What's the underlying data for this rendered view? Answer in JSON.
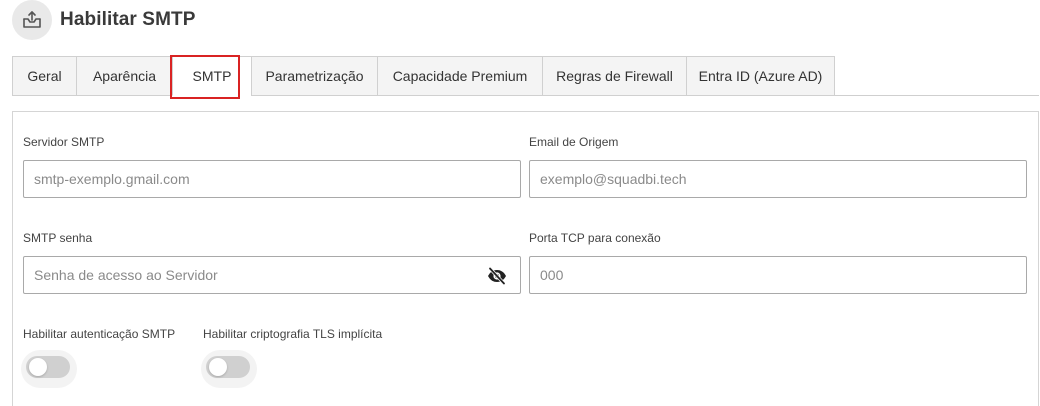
{
  "header": {
    "title": "Habilitar SMTP",
    "icon": "mail-export-icon"
  },
  "tabs": [
    {
      "label": "Geral",
      "active": false
    },
    {
      "label": "Aparência",
      "active": false
    },
    {
      "label": "SMTP",
      "active": true
    },
    {
      "label": "Parametrização",
      "active": false
    },
    {
      "label": "Capacidade Premium",
      "active": false
    },
    {
      "label": "Regras de Firewall",
      "active": false
    },
    {
      "label": "Entra ID (Azure AD)",
      "active": false
    }
  ],
  "form": {
    "smtp_server": {
      "label": "Servidor SMTP",
      "placeholder": "smtp-exemplo.gmail.com",
      "value": ""
    },
    "origin_email": {
      "label": "Email de Origem",
      "placeholder": "exemplo@squadbi.tech",
      "value": ""
    },
    "smtp_password": {
      "label": "SMTP senha",
      "placeholder": "Senha de acesso ao Servidor",
      "value": "",
      "icon": "eye-slash-icon"
    },
    "tcp_port": {
      "label": "Porta TCP para conexão",
      "placeholder": "000",
      "value": ""
    },
    "auth_toggle": {
      "label": "Habilitar autenticação SMTP",
      "enabled": false
    },
    "tls_toggle": {
      "label": "Habilitar criptografia TLS implícita",
      "enabled": false
    }
  },
  "colors": {
    "highlight": "#d92323",
    "toggle_off": "#d0d0d0",
    "tab_bg": "#f4f4f4"
  }
}
